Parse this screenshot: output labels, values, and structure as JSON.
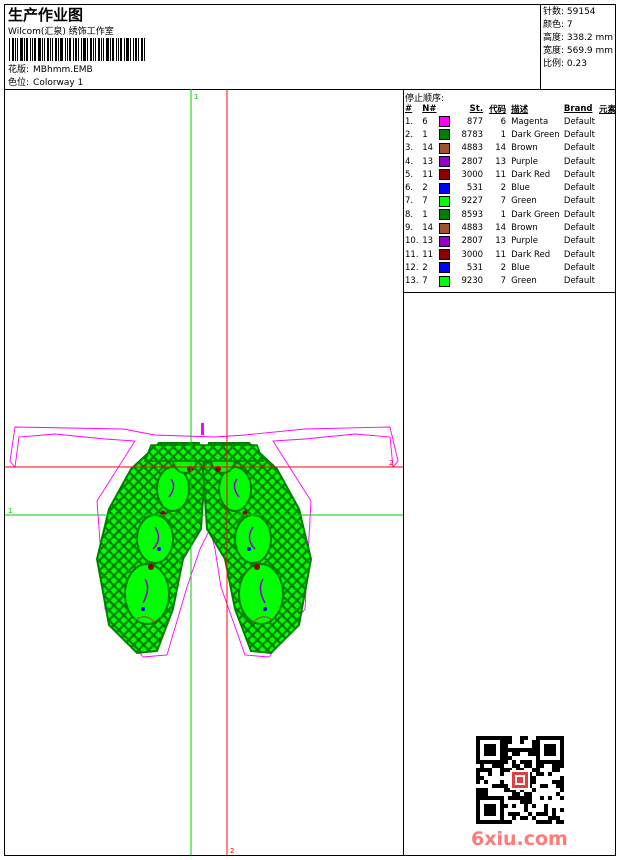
{
  "header": {
    "title": "生产作业图",
    "company": "Wilcom(汇泉) 绣饰工作室",
    "design_label": "花版:",
    "design_value": "MBhmm.EMB",
    "colorway_label": "色位:",
    "colorway_value": "Colorway 1"
  },
  "stats": {
    "stitches": "针数: 59154",
    "colors": "颜色: 7",
    "height": "高度: 338.2 mm",
    "width": "宽度: 569.9 mm",
    "scale": "比例: 0.23"
  },
  "stop_sequence": {
    "title": "停止顺序:",
    "headers": [
      "#",
      "N#",
      "St.",
      "代码",
      "描述",
      "Brand",
      "元素"
    ],
    "rows": [
      {
        "idx": "1.",
        "n": "6",
        "color": "#ff00ff",
        "st": "877",
        "code": "6",
        "desc": "Magenta",
        "brand": "Default"
      },
      {
        "idx": "2.",
        "n": "1",
        "color": "#008000",
        "st": "8783",
        "code": "1",
        "desc": "Dark Green",
        "brand": "Default"
      },
      {
        "idx": "3.",
        "n": "14",
        "color": "#a0522d",
        "st": "4883",
        "code": "14",
        "desc": "Brown",
        "brand": "Default"
      },
      {
        "idx": "4.",
        "n": "13",
        "color": "#9400d3",
        "st": "2807",
        "code": "13",
        "desc": "Purple",
        "brand": "Default"
      },
      {
        "idx": "5.",
        "n": "11",
        "color": "#8b0000",
        "st": "3000",
        "code": "11",
        "desc": "Dark Red",
        "brand": "Default"
      },
      {
        "idx": "6.",
        "n": "2",
        "color": "#0000ff",
        "st": "531",
        "code": "2",
        "desc": "Blue",
        "brand": "Default"
      },
      {
        "idx": "7.",
        "n": "7",
        "color": "#00ff00",
        "st": "9227",
        "code": "7",
        "desc": "Green",
        "brand": "Default"
      },
      {
        "idx": "8.",
        "n": "1",
        "color": "#008000",
        "st": "8593",
        "code": "1",
        "desc": "Dark Green",
        "brand": "Default"
      },
      {
        "idx": "9.",
        "n": "14",
        "color": "#a0522d",
        "st": "4883",
        "code": "14",
        "desc": "Brown",
        "brand": "Default"
      },
      {
        "idx": "10.",
        "n": "13",
        "color": "#9400d3",
        "st": "2807",
        "code": "13",
        "desc": "Purple",
        "brand": "Default"
      },
      {
        "idx": "11.",
        "n": "11",
        "color": "#8b0000",
        "st": "3000",
        "code": "11",
        "desc": "Dark Red",
        "brand": "Default"
      },
      {
        "idx": "12.",
        "n": "2",
        "color": "#0000ff",
        "st": "531",
        "code": "2",
        "desc": "Blue",
        "brand": "Default"
      },
      {
        "idx": "13.",
        "n": "7",
        "color": "#00ff00",
        "st": "9230",
        "code": "7",
        "desc": "Green",
        "brand": "Default"
      }
    ]
  },
  "canvas": {
    "guide_labels": {
      "top": "1",
      "right": "2",
      "left": "1",
      "bottom": "2"
    },
    "colors": {
      "guide_green": "#00cc00",
      "guide_red": "#ff0000",
      "outline": "#ff00ff",
      "dark_green": "#008000",
      "bright_green": "#00ff00"
    }
  },
  "watermark": "6xiu.com"
}
